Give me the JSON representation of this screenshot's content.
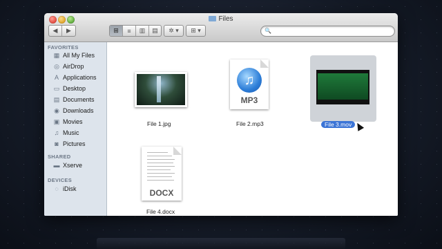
{
  "window": {
    "title": "Files"
  },
  "toolbar": {
    "back_label": "◀",
    "forward_label": "▶",
    "view_icon_label": "⊞",
    "view_list_label": "≡",
    "view_column_label": "▥",
    "view_flow_label": "▤",
    "action_label": "✲ ▾",
    "arrange_label": "⊞ ▾"
  },
  "search": {
    "icon": "🔍",
    "placeholder": ""
  },
  "sidebar": {
    "favorites_header": "FAVORITES",
    "favorites": [
      {
        "label": "All My Files",
        "icon": "▦"
      },
      {
        "label": "AirDrop",
        "icon": "◎"
      },
      {
        "label": "Applications",
        "icon": "A"
      },
      {
        "label": "Desktop",
        "icon": "▭"
      },
      {
        "label": "Documents",
        "icon": "▤"
      },
      {
        "label": "Downloads",
        "icon": "◉"
      },
      {
        "label": "Movies",
        "icon": "▣"
      },
      {
        "label": "Music",
        "icon": "♫"
      },
      {
        "label": "Pictures",
        "icon": "◙"
      }
    ],
    "shared_header": "SHARED",
    "shared": [
      {
        "label": "Xserve",
        "icon": "▬"
      }
    ],
    "devices_header": "DEVICES",
    "devices": [
      {
        "label": "iDisk",
        "icon": "◌"
      }
    ]
  },
  "files": [
    {
      "name": "File 1.jpg",
      "kind": "image-thumbnail"
    },
    {
      "name": "File 2.mp3",
      "kind": "itunes-audio",
      "badge": "MP3"
    },
    {
      "name": "File 3.mov",
      "kind": "movie-thumbnail",
      "selected": true
    },
    {
      "name": "File 4.docx",
      "kind": "document",
      "badge": "DOCX"
    }
  ]
}
